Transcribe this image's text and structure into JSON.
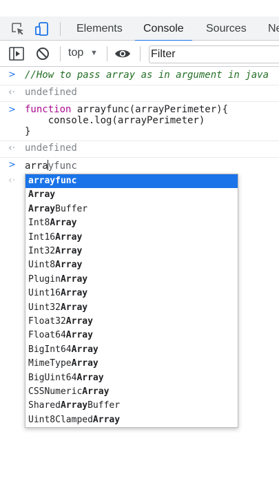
{
  "tabs": [
    "Elements",
    "Console",
    "Sources",
    "Ne"
  ],
  "active_tab": "Console",
  "toolbar": {
    "context": "top",
    "filter_placeholder": "Filter"
  },
  "console": {
    "entries": [
      {
        "kind": "input",
        "text": "//How to pass array as in argument in java"
      },
      {
        "kind": "output",
        "text": "undefined"
      },
      {
        "kind": "input",
        "lines": [
          "function",
          " arrayfunc(arrayPerimeter){",
          "    console.log(arrayPerimeter)",
          "}"
        ]
      },
      {
        "kind": "output",
        "text": "undefined"
      },
      {
        "kind": "input",
        "typed_before_caret": "arra",
        "typed_after_caret": "yfunc"
      }
    ]
  },
  "autocomplete": {
    "selected_index": 0,
    "items": [
      {
        "pre": "",
        "match": "arrayfunc",
        "post": ""
      },
      {
        "pre": "",
        "match": "Array",
        "post": ""
      },
      {
        "pre": "",
        "match": "Array",
        "post": "Buffer"
      },
      {
        "pre": "Int8",
        "match": "Array",
        "post": ""
      },
      {
        "pre": "Int16",
        "match": "Array",
        "post": ""
      },
      {
        "pre": "Int32",
        "match": "Array",
        "post": ""
      },
      {
        "pre": "Uint8",
        "match": "Array",
        "post": ""
      },
      {
        "pre": "Plugin",
        "match": "Array",
        "post": ""
      },
      {
        "pre": "Uint16",
        "match": "Array",
        "post": ""
      },
      {
        "pre": "Uint32",
        "match": "Array",
        "post": ""
      },
      {
        "pre": "Float32",
        "match": "Array",
        "post": ""
      },
      {
        "pre": "Float64",
        "match": "Array",
        "post": ""
      },
      {
        "pre": "BigInt64",
        "match": "Array",
        "post": ""
      },
      {
        "pre": "MimeType",
        "match": "Array",
        "post": ""
      },
      {
        "pre": "BigUint64",
        "match": "Array",
        "post": ""
      },
      {
        "pre": "CSSNumeric",
        "match": "Array",
        "post": ""
      },
      {
        "pre": "Shared",
        "match": "Array",
        "post": "Buffer"
      },
      {
        "pre": "Uint8Clamped",
        "match": "Array",
        "post": ""
      }
    ]
  },
  "colors": {
    "accent": "#1a73e8",
    "comment": "#236e25",
    "keyword": "#aa0d91",
    "muted": "#80868b"
  }
}
